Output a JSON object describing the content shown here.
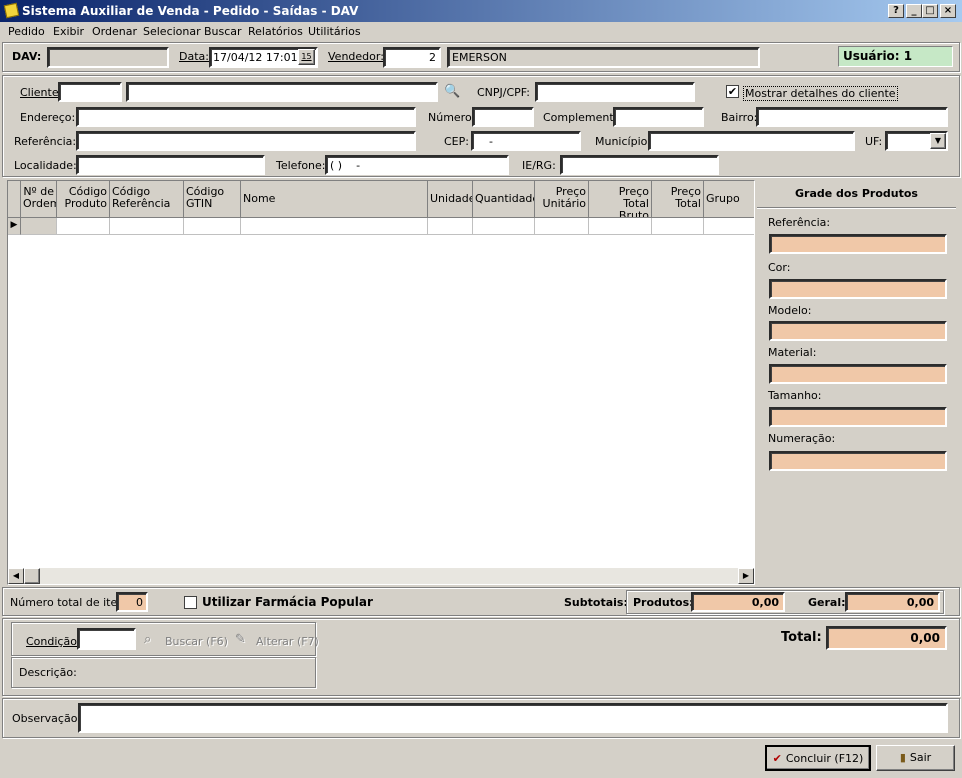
{
  "window": {
    "title": "Sistema Auxiliar de Venda - Pedido - Saídas - DAV",
    "help": "?",
    "minimize": "_",
    "maximize": "□",
    "close": "×"
  },
  "menu": [
    "Pedido",
    "Exibir",
    "Ordenar",
    "Selecionar",
    "Buscar",
    "Relatórios",
    "Utilitários"
  ],
  "header": {
    "dav_label": "DAV:",
    "dav_value": "",
    "data_label": "Data:",
    "data_value": "17/04/12 17:01",
    "calendar_icon": "15",
    "vendedor_label": "Vendedor:",
    "vendedor_code": "2",
    "vendedor_name": "EMERSON",
    "usuario": "Usuário: 1"
  },
  "cliente": {
    "cliente_label": "Cliente:",
    "cliente_code": "",
    "cliente_name": "",
    "cnpj_label": "CNPJ/CPF:",
    "cnpj_value": "",
    "mostrar_label": "Mostrar detalhes do cliente",
    "mostrar_checked": true,
    "endereco_label": "Endereço:",
    "numero_label": "Número:",
    "complemento_label": "Complemento:",
    "bairro_label": "Bairro:",
    "referencia_label": "Referência:",
    "cep_label": "CEP:",
    "cep_value": "-",
    "municipio_label": "Município:",
    "uf_label": "UF:",
    "localidade_label": "Localidade:",
    "telefone_label": "Telefone:",
    "telefone_value": "( )    -",
    "ierg_label": "IE/RG:"
  },
  "grid": {
    "columns": [
      {
        "label": "Nº de Ordem"
      },
      {
        "label": "Código Produto"
      },
      {
        "label": "Código Referência"
      },
      {
        "label": "Código GTIN"
      },
      {
        "label": "Nome"
      },
      {
        "label": "Unidade"
      },
      {
        "label": "Quantidade"
      },
      {
        "label": "Preço Unitário"
      },
      {
        "label": "Preço Total Bruto"
      },
      {
        "label": "Preço Total"
      },
      {
        "label": "Grupo"
      }
    ]
  },
  "grade": {
    "title": "Grade dos Produtos",
    "fields": [
      "Referência:",
      "Cor:",
      "Modelo:",
      "Material:",
      "Tamanho:",
      "Numeração:"
    ]
  },
  "totals": {
    "num_itens_label": "Número total de itens:",
    "num_itens_value": "0",
    "farmacia_label": "Utilizar Farmácia Popular",
    "subtotais_label": "Subtotais:",
    "produtos_label": "Produtos:",
    "produtos_value": "0,00",
    "geral_label": "Geral:",
    "geral_value": "0,00",
    "total_label": "Total:",
    "total_value": "0,00"
  },
  "condicao": {
    "condicao_label": "Condição:",
    "buscar_label": "Buscar (F6)",
    "alterar_label": "Alterar (F7)",
    "descricao_label": "Descrição:"
  },
  "observacao": {
    "label": "Observação:"
  },
  "footer": {
    "concluir_label": "Concluir (F12)",
    "sair_label": "Sair"
  }
}
